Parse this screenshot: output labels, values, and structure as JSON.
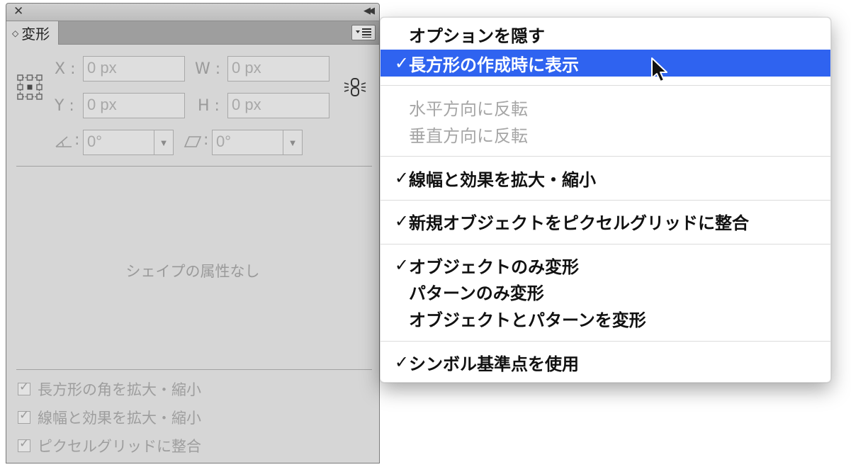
{
  "panel": {
    "title": "変形",
    "tab_updown_glyph": "◇",
    "fields": {
      "x_label": "X :",
      "x_value": "0 px",
      "y_label": "Y :",
      "y_value": "0 px",
      "w_label": "W :",
      "w_value": "0 px",
      "h_label": "H :",
      "h_value": "0 px",
      "rotate_value": "0°",
      "shear_value": "0°",
      "colon": ":"
    },
    "no_shape_attributes": "シェイプの属性なし",
    "checkboxes": [
      {
        "label": "長方形の角を拡大・縮小",
        "checked": true
      },
      {
        "label": "線幅と効果を拡大・縮小",
        "checked": true
      },
      {
        "label": "ピクセルグリッドに整合",
        "checked": true
      }
    ]
  },
  "menu": {
    "check_glyph": "✓",
    "items": [
      {
        "label": "オプションを隠す",
        "checked": false,
        "enabled": true,
        "highlighted": false
      },
      {
        "label": "長方形の作成時に表示",
        "checked": true,
        "enabled": true,
        "highlighted": true
      },
      {
        "label": "水平方向に反転",
        "checked": false,
        "enabled": false,
        "highlighted": false
      },
      {
        "label": "垂直方向に反転",
        "checked": false,
        "enabled": false,
        "highlighted": false
      },
      {
        "label": "線幅と効果を拡大・縮小",
        "checked": true,
        "enabled": true,
        "highlighted": false
      },
      {
        "label": "新規オブジェクトをピクセルグリッドに整合",
        "checked": true,
        "enabled": true,
        "highlighted": false
      },
      {
        "label": "オブジェクトのみ変形",
        "checked": true,
        "enabled": true,
        "highlighted": false
      },
      {
        "label": "パターンのみ変形",
        "checked": false,
        "enabled": true,
        "highlighted": false
      },
      {
        "label": "オブジェクトとパターンを変形",
        "checked": false,
        "enabled": true,
        "highlighted": false
      },
      {
        "label": "シンボル基準点を使用",
        "checked": true,
        "enabled": true,
        "highlighted": false
      }
    ]
  },
  "colors": {
    "highlight": "#2f63f0",
    "panel_bg": "#d6d6d6",
    "disabled_text": "#a6a6a6"
  }
}
